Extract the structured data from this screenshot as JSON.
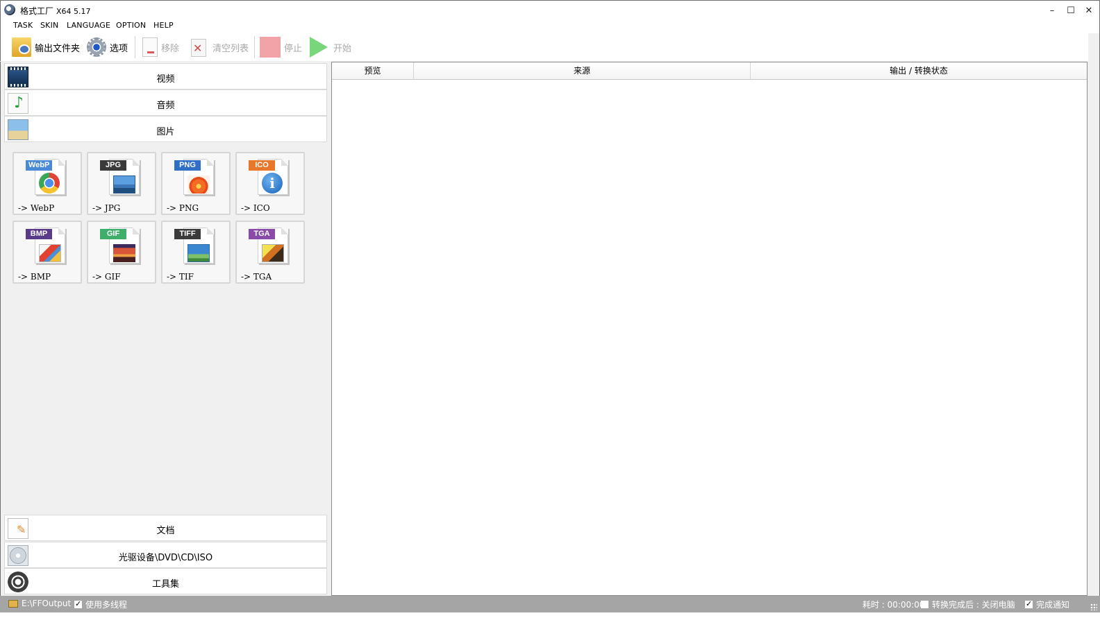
{
  "window": {
    "title": "格式工厂",
    "version": "X64 5.17",
    "controls": {
      "minimize": "–",
      "maximize": "☐",
      "close": "✕"
    }
  },
  "menu": [
    "TASK",
    "SKIN",
    "LANGUAGE",
    "OPTION",
    "HELP"
  ],
  "toolbar": {
    "output_folder": "输出文件夹",
    "options": "选项",
    "remove": "移除",
    "clear_list": "清空列表",
    "stop": "停止",
    "start": "开始"
  },
  "categories": {
    "video": "视频",
    "audio": "音频",
    "picture": "图片",
    "document": "文档",
    "dvd": "光驱设备\\DVD\\CD\\ISO",
    "tools": "工具集"
  },
  "picture_formats": [
    {
      "tag": "WebP",
      "label": "-> WebP",
      "color": "#4a88d8"
    },
    {
      "tag": "JPG",
      "label": "-> JPG",
      "color": "#3a3a3a"
    },
    {
      "tag": "PNG",
      "label": "-> PNG",
      "color": "#2f6fc8"
    },
    {
      "tag": "ICO",
      "label": "-> ICO",
      "color": "#e8772a"
    },
    {
      "tag": "BMP",
      "label": "-> BMP",
      "color": "#5a3a8a"
    },
    {
      "tag": "GIF",
      "label": "-> GIF",
      "color": "#3fae6a"
    },
    {
      "tag": "TIFF",
      "label": "-> TIF",
      "color": "#3a3a3a"
    },
    {
      "tag": "TGA",
      "label": "-> TGA",
      "color": "#8a4aa8"
    }
  ],
  "ico_glyph": "i",
  "table": {
    "columns": [
      "预览",
      "来源",
      "输出 / 转换状态"
    ]
  },
  "status": {
    "output_path": "E:\\FFOutput",
    "multithread": "使用多线程",
    "multithread_checked": true,
    "elapsed": "耗时 : 00:00:00",
    "after_convert": "转换完成后 : 关闭电脑",
    "after_convert_checked": false,
    "notify": "完成通知",
    "notify_checked": true
  }
}
